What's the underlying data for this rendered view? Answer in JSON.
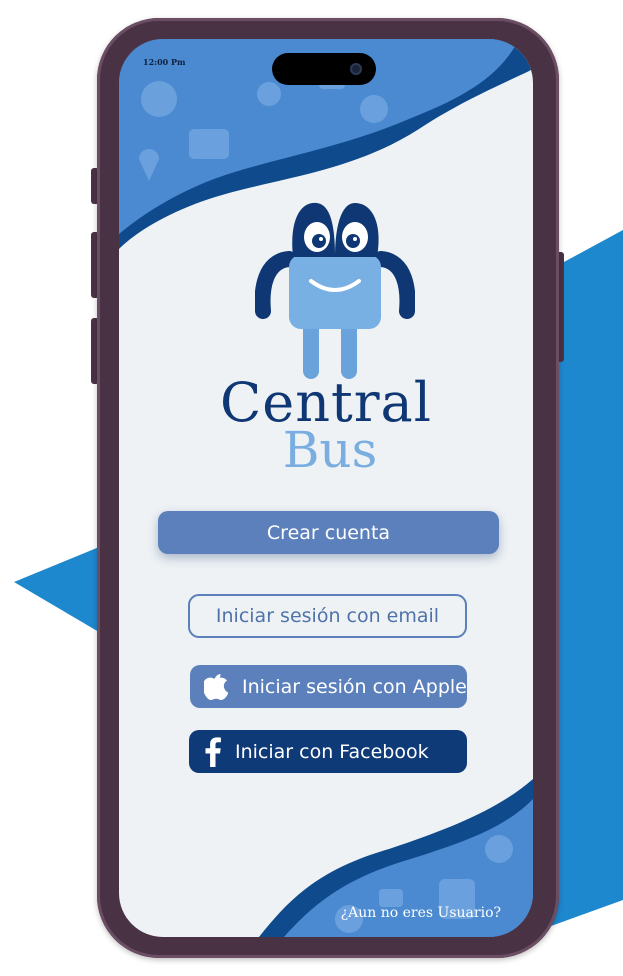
{
  "status_bar": {
    "time": "12:00 Pm"
  },
  "logo": {
    "line1": "Central",
    "line2": "Bus"
  },
  "buttons": {
    "create_account": "Crear cuenta",
    "email_login": "Iniciar sesión con email",
    "apple_login": "Iniciar sesión con Apple",
    "facebook_login": "Iniciar con Facebook"
  },
  "footer": {
    "signup_link": "¿Aun no eres Usuario?"
  },
  "colors": {
    "primary": "#5b80bb",
    "dark_blue": "#0f3a78",
    "logo_dark": "#0f3773",
    "logo_light": "#7aaee0",
    "screen_bg": "#eef2f5",
    "accent_bg": "#1e88cf"
  },
  "icons": [
    "apple-icon",
    "facebook-icon",
    "camera-icon",
    "mascot-logo"
  ]
}
